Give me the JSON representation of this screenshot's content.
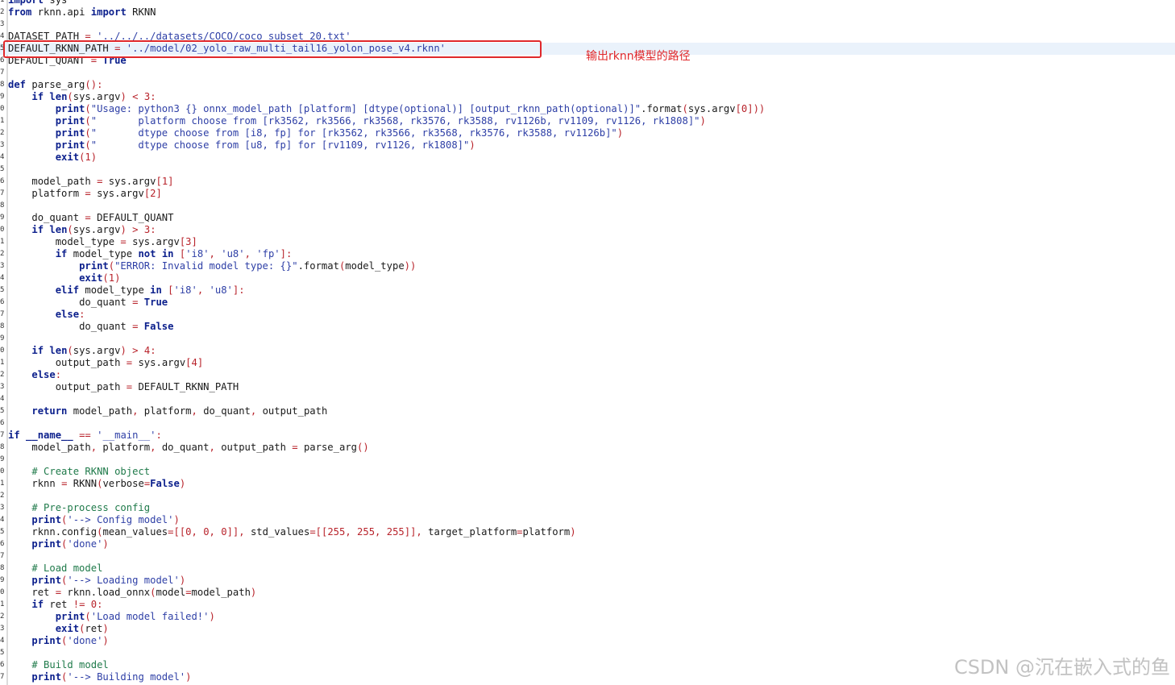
{
  "annotation": "输出rknn模型的路径",
  "watermark": "CSDN @沉在嵌入式的鱼",
  "colors": {
    "keyword": "#0b1f8c",
    "string": "#2e3fa6",
    "number": "#b8232b",
    "comment": "#1f7a4a",
    "highlight": "#eaf2fb",
    "annotation": "#e0282b"
  },
  "lines": [
    {
      "n": "1",
      "text": "import sys"
    },
    {
      "n": "2",
      "text": "from rknn.api import RKNN"
    },
    {
      "n": "3",
      "text": ""
    },
    {
      "n": "4",
      "text": "DATASET_PATH = '../../../datasets/COCO/coco_subset_20.txt'"
    },
    {
      "n": "5",
      "text": "DEFAULT_RKNN_PATH = '../model/02_yolo_raw_multi_tail16_yolon_pose_v4.rknn'"
    },
    {
      "n": "6",
      "text": "DEFAULT_QUANT = True"
    },
    {
      "n": "7",
      "text": ""
    },
    {
      "n": "8",
      "text": "def parse_arg():"
    },
    {
      "n": "9",
      "text": "    if len(sys.argv) < 3:"
    },
    {
      "n": "0",
      "text": "        print(\"Usage: python3 {} onnx_model_path [platform] [dtype(optional)] [output_rknn_path(optional)]\".format(sys.argv[0]))"
    },
    {
      "n": "1",
      "text": "        print(\"       platform choose from [rk3562, rk3566, rk3568, rk3576, rk3588, rv1126b, rv1109, rv1126, rk1808]\")"
    },
    {
      "n": "2",
      "text": "        print(\"       dtype choose from [i8, fp] for [rk3562, rk3566, rk3568, rk3576, rk3588, rv1126b]\")"
    },
    {
      "n": "3",
      "text": "        print(\"       dtype choose from [u8, fp] for [rv1109, rv1126, rk1808]\")"
    },
    {
      "n": "4",
      "text": "        exit(1)"
    },
    {
      "n": "5",
      "text": ""
    },
    {
      "n": "6",
      "text": "    model_path = sys.argv[1]"
    },
    {
      "n": "7",
      "text": "    platform = sys.argv[2]"
    },
    {
      "n": "8",
      "text": ""
    },
    {
      "n": "9",
      "text": "    do_quant = DEFAULT_QUANT"
    },
    {
      "n": "0",
      "text": "    if len(sys.argv) > 3:"
    },
    {
      "n": "1",
      "text": "        model_type = sys.argv[3]"
    },
    {
      "n": "2",
      "text": "        if model_type not in ['i8', 'u8', 'fp']:"
    },
    {
      "n": "3",
      "text": "            print(\"ERROR: Invalid model type: {}\".format(model_type))"
    },
    {
      "n": "4",
      "text": "            exit(1)"
    },
    {
      "n": "5",
      "text": "        elif model_type in ['i8', 'u8']:"
    },
    {
      "n": "6",
      "text": "            do_quant = True"
    },
    {
      "n": "7",
      "text": "        else:"
    },
    {
      "n": "8",
      "text": "            do_quant = False"
    },
    {
      "n": "9",
      "text": ""
    },
    {
      "n": "0",
      "text": "    if len(sys.argv) > 4:"
    },
    {
      "n": "1",
      "text": "        output_path = sys.argv[4]"
    },
    {
      "n": "2",
      "text": "    else:"
    },
    {
      "n": "3",
      "text": "        output_path = DEFAULT_RKNN_PATH"
    },
    {
      "n": "4",
      "text": ""
    },
    {
      "n": "5",
      "text": "    return model_path, platform, do_quant, output_path"
    },
    {
      "n": "6",
      "text": ""
    },
    {
      "n": "7",
      "text": "if __name__ == '__main__':"
    },
    {
      "n": "8",
      "text": "    model_path, platform, do_quant, output_path = parse_arg()"
    },
    {
      "n": "9",
      "text": ""
    },
    {
      "n": "0",
      "text": "    # Create RKNN object"
    },
    {
      "n": "1",
      "text": "    rknn = RKNN(verbose=False)"
    },
    {
      "n": "2",
      "text": ""
    },
    {
      "n": "3",
      "text": "    # Pre-process config"
    },
    {
      "n": "4",
      "text": "    print('--> Config model')"
    },
    {
      "n": "5",
      "text": "    rknn.config(mean_values=[[0, 0, 0]], std_values=[[255, 255, 255]], target_platform=platform)"
    },
    {
      "n": "6",
      "text": "    print('done')"
    },
    {
      "n": "7",
      "text": ""
    },
    {
      "n": "8",
      "text": "    # Load model"
    },
    {
      "n": "9",
      "text": "    print('--> Loading model')"
    },
    {
      "n": "0",
      "text": "    ret = rknn.load_onnx(model=model_path)"
    },
    {
      "n": "1",
      "text": "    if ret != 0:"
    },
    {
      "n": "2",
      "text": "        print('Load model failed!')"
    },
    {
      "n": "3",
      "text": "        exit(ret)"
    },
    {
      "n": "4",
      "text": "    print('done')"
    },
    {
      "n": "5",
      "text": ""
    },
    {
      "n": "6",
      "text": "    # Build model"
    },
    {
      "n": "7",
      "text": "    print('--> Building model')"
    }
  ]
}
